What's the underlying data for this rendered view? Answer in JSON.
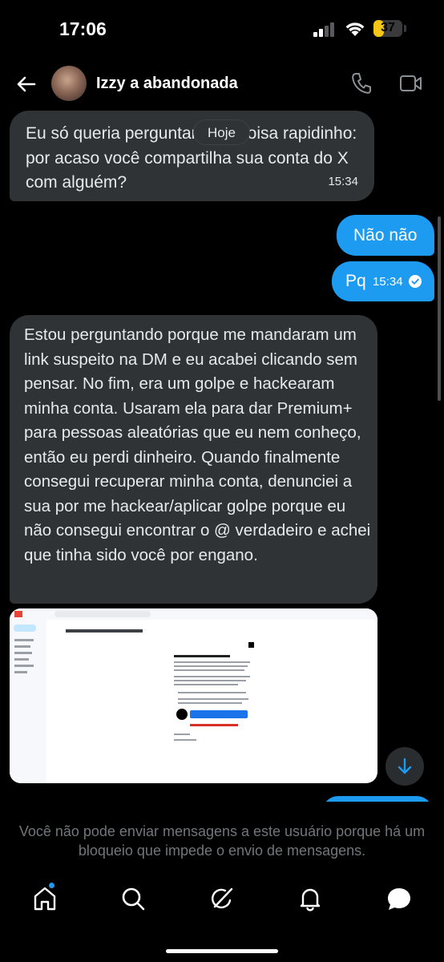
{
  "status_bar": {
    "time": "17:06",
    "battery": "37",
    "battery_level": 0.37
  },
  "header": {
    "contact_name": "Izzy a abandonada"
  },
  "chat": {
    "date_separator": "Hoje",
    "messages": [
      {
        "direction": "in",
        "text": "Eu só queria perguntar uma coisa rapidinho: por acaso você compartilha sua conta do X com alguém?",
        "time": "15:34"
      },
      {
        "direction": "out",
        "text": "Não não"
      },
      {
        "direction": "out",
        "text": "Pq",
        "time": "15:34",
        "status": "read"
      },
      {
        "direction": "in",
        "text": "Estou perguntando porque me mandaram um link suspeito na DM e eu acabei clicando sem pensar. No fim, era um golpe e hackearam minha conta. Usaram ela para dar Premium+ para pessoas aleatórias que eu nem conheço, então eu perdi dinheiro. Quando finalmente consegui recuperar minha conta, denunciei a sua por me hackear/aplicar golpe porque eu não consegui encontrar o @ verdadeiro e achei que tinha sido você por engano."
      }
    ],
    "attachment": {
      "type": "image",
      "app": "Gmail",
      "subject": "RE: Account Compromised - TICKET #5257418"
    }
  },
  "footer": {
    "blocked_notice": "Você não pode enviar mensagens a este usuário porque há um bloqueio que impede o envio de mensagens."
  },
  "nav": {
    "items": [
      "home-icon",
      "search-icon",
      "grok-icon",
      "notifications-icon",
      "messages-icon"
    ],
    "active": "messages-icon"
  },
  "colors": {
    "accent": "#1d9bf0",
    "incoming_bubble": "#2f3336",
    "background": "#000000",
    "muted_text": "#71767b"
  }
}
